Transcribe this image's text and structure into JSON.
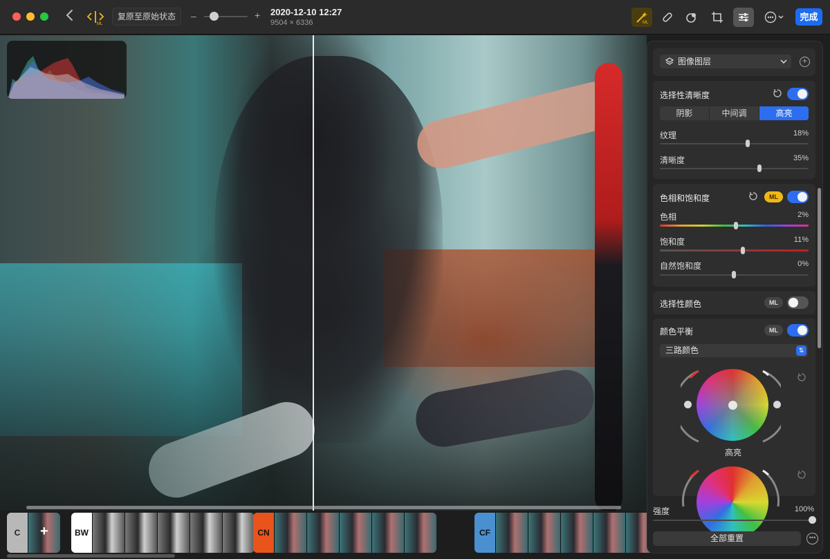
{
  "window": {
    "revert_label": "复原至原始状态",
    "zoom_minus": "–",
    "zoom_plus": "+",
    "title": "2020-12-10 12:27",
    "subtitle": "9504 × 6336",
    "done_label": "完成",
    "traffic_colors": [
      "#fe5f57",
      "#febc2e",
      "#28c840"
    ],
    "accent_color": "#1b6cf2",
    "ml_color": "#f0b816"
  },
  "toolbar_tools": [
    {
      "name": "ml-enhance-icon",
      "active": true
    },
    {
      "name": "retouch-bandage-icon",
      "active": false
    },
    {
      "name": "color-adjust-icon",
      "active": false
    },
    {
      "name": "crop-icon",
      "active": false
    },
    {
      "name": "adjust-sliders-icon",
      "active": true
    },
    {
      "name": "more-options-icon",
      "active": false
    }
  ],
  "filmstrip": {
    "groups": [
      {
        "cap": "C",
        "cap_bg": "#b8b8b8",
        "cap_fg": "#222",
        "thumbs": 1,
        "kind": "color"
      },
      {
        "cap": "BW",
        "cap_bg": "#ffffff",
        "cap_fg": "#111",
        "thumbs": 5,
        "kind": "bw"
      },
      {
        "cap": "CN",
        "cap_bg": "#e8541c",
        "cap_fg": "#111",
        "thumbs": 5,
        "kind": "color"
      },
      {
        "cap": "CF",
        "cap_bg": "#4a90d0",
        "cap_fg": "#111",
        "thumbs": 5,
        "kind": "color"
      }
    ]
  },
  "panel": {
    "layer_dropdown": "图像图层",
    "selective_clarity": {
      "title": "选择性清晰度",
      "enabled": true,
      "tabs": [
        "阴影",
        "中间调",
        "高亮"
      ],
      "selected_tab": 2,
      "sliders": [
        {
          "label": "纹理",
          "value": "18%",
          "fraction": 0.59
        },
        {
          "label": "清晰度",
          "value": "35%",
          "fraction": 0.67
        }
      ]
    },
    "hue_saturation": {
      "title": "色相和饱和度",
      "ml_label": "ML",
      "enabled": true,
      "sliders": [
        {
          "label": "色相",
          "value": "2%",
          "fraction": 0.51,
          "kind": "hue"
        },
        {
          "label": "饱和度",
          "value": "11%",
          "fraction": 0.555,
          "kind": "sat"
        },
        {
          "label": "自然饱和度",
          "value": "0%",
          "fraction": 0.5,
          "kind": "plain"
        }
      ]
    },
    "selective_color": {
      "title": "选择性颜色",
      "ml_label": "ML",
      "enabled": false
    },
    "color_balance": {
      "title": "颜色平衡",
      "ml_label": "ML",
      "enabled": true,
      "mode": "三路颜色",
      "wheel_label": "高亮"
    },
    "strength": {
      "label": "强度",
      "value": "100%",
      "fraction": 1.0
    },
    "reset_all": "全部重置"
  }
}
